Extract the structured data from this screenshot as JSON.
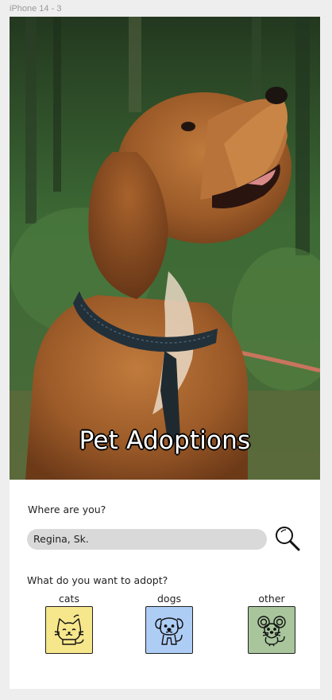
{
  "frame": {
    "label": "iPhone 14 - 3"
  },
  "hero": {
    "title": "Pet Adoptions"
  },
  "location": {
    "question": "Where are you?",
    "value": "Regina, Sk."
  },
  "adopt": {
    "question": "What do you want to adopt?",
    "options": [
      {
        "label": "cats",
        "icon": "cat-icon",
        "color": "#f6e68c"
      },
      {
        "label": "dogs",
        "icon": "dog-icon",
        "color": "#aecdf5"
      },
      {
        "label": "other",
        "icon": "mouse-icon",
        "color": "#a8c59c"
      }
    ]
  }
}
